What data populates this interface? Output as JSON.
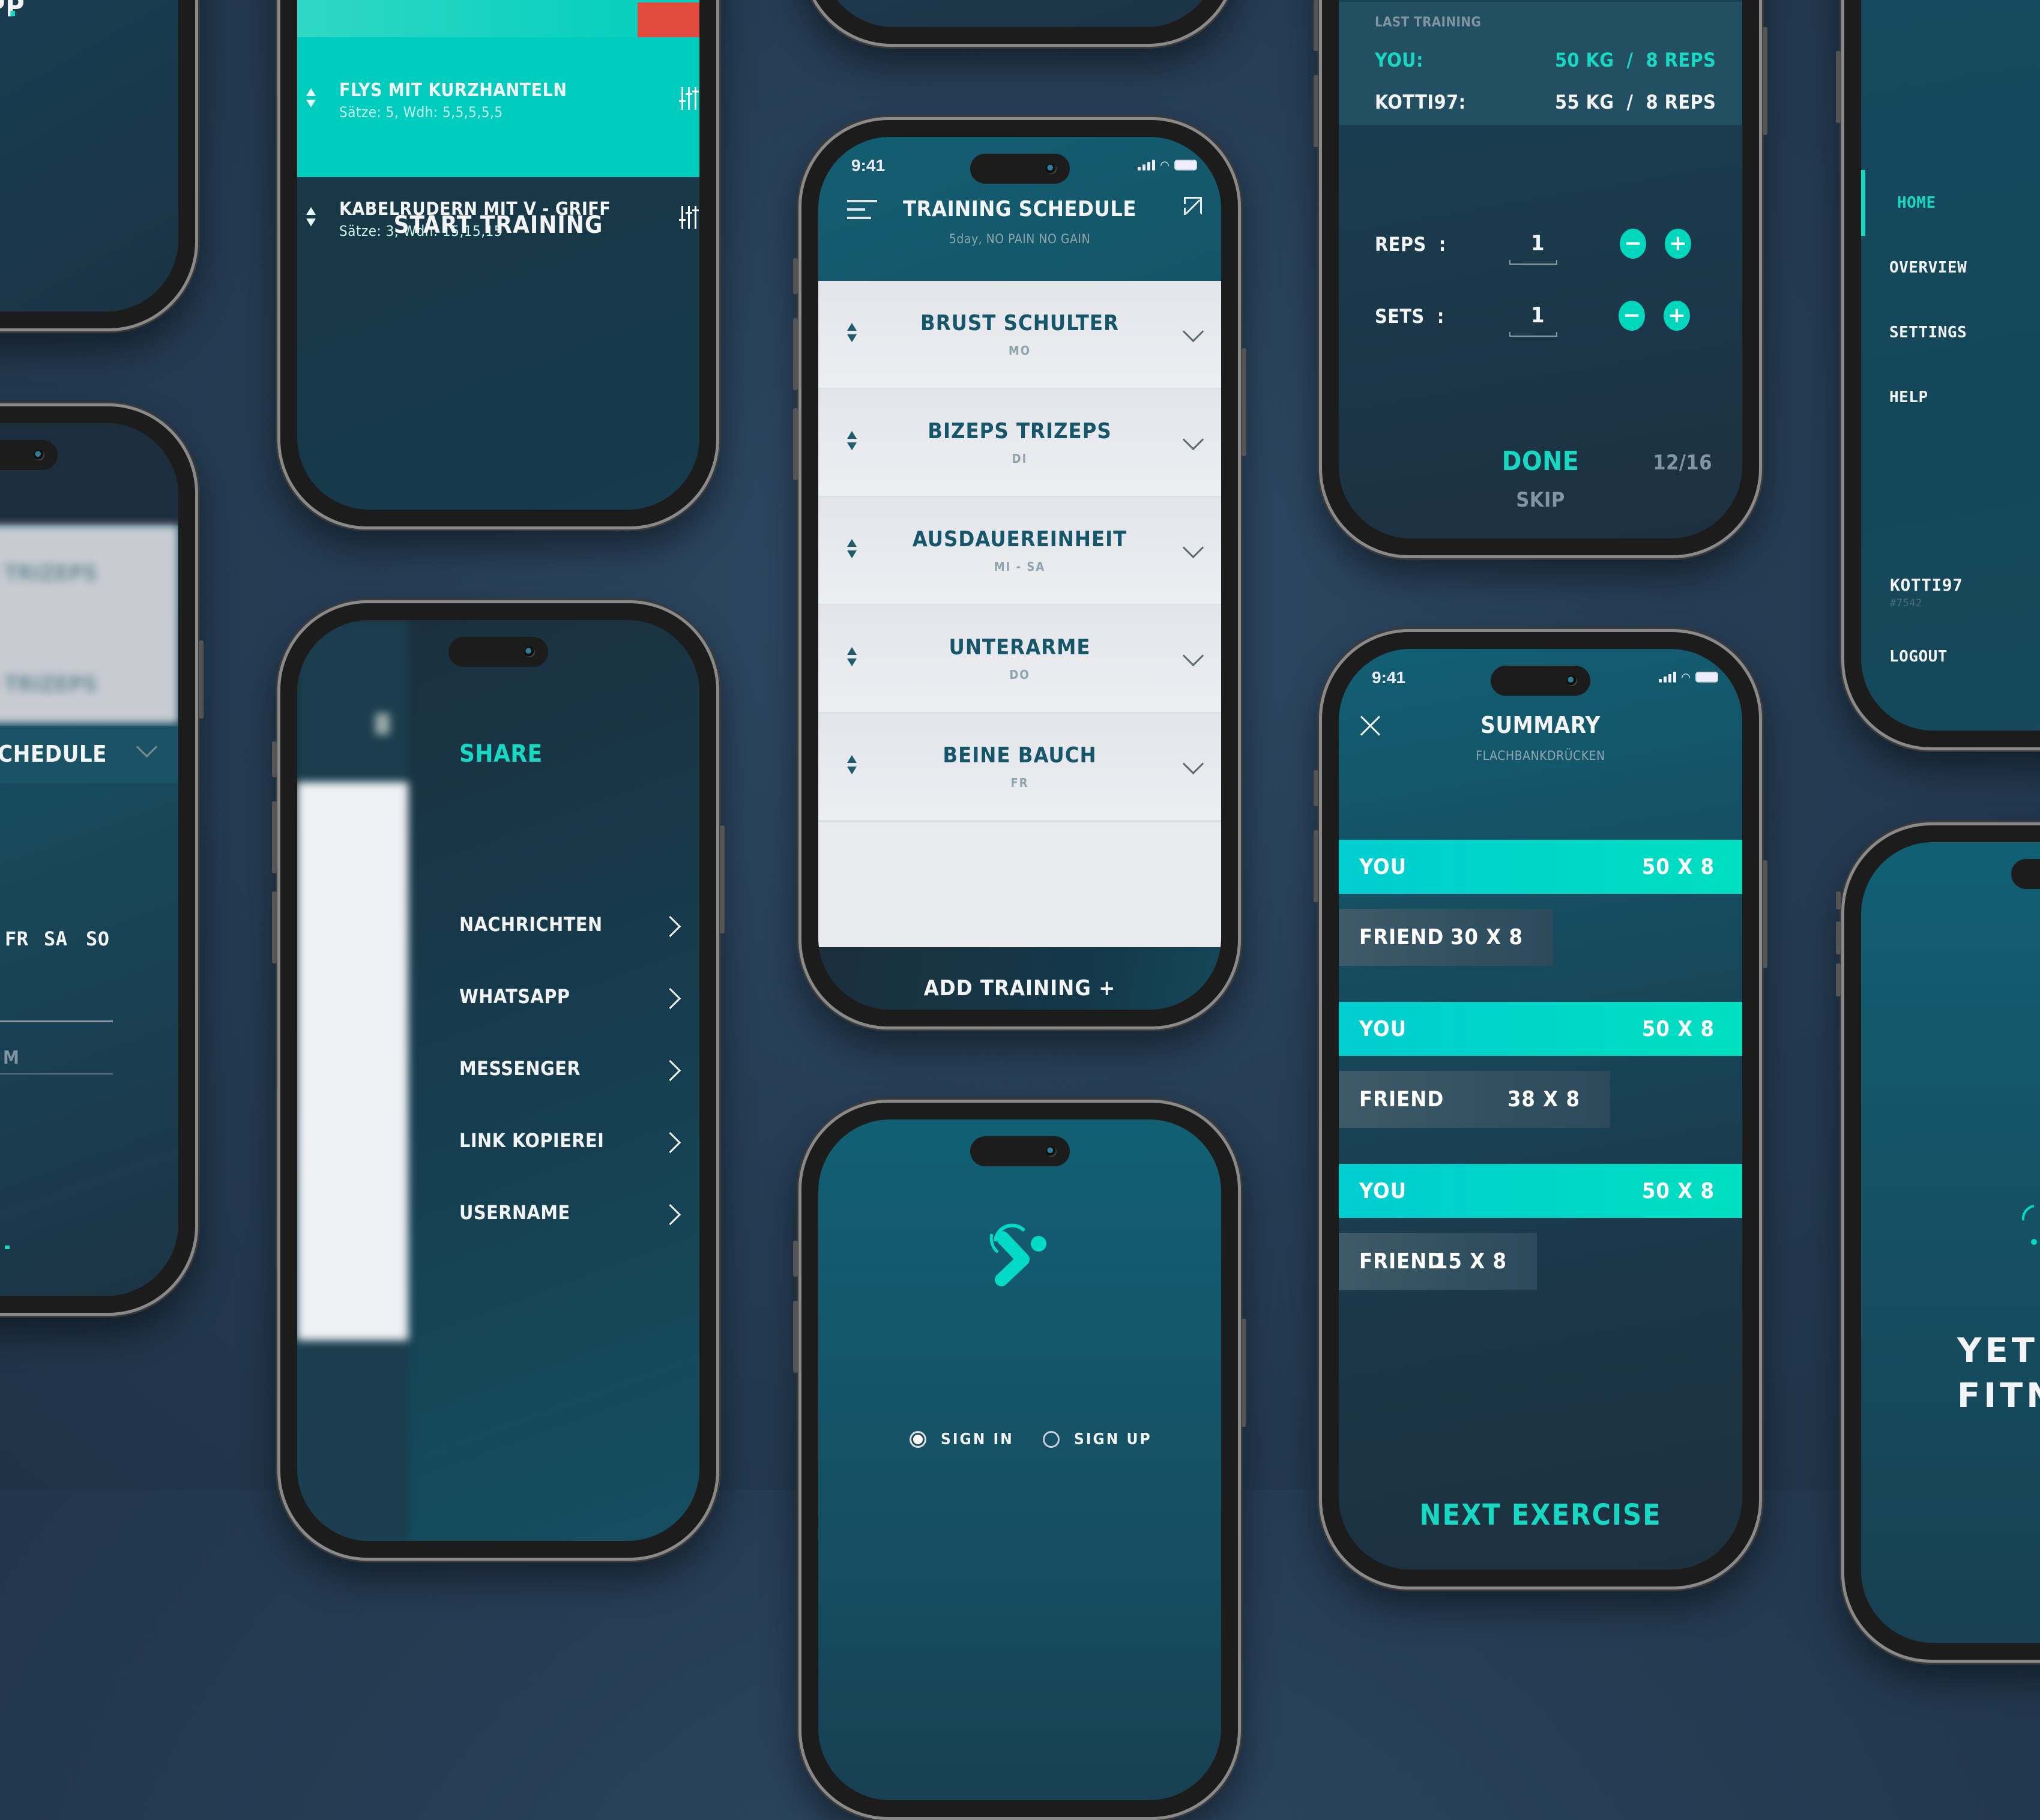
{
  "colors": {
    "accent_teal": "#16d9c3",
    "background": "#263d55",
    "screen_dark": "#174a5d",
    "list_light": "#e6e8ec",
    "alert_red": "#e34b3e"
  },
  "phone_top_left": {
    "title_fragment": "APP",
    "title_dot": "."
  },
  "phone_blurred_schedule": {
    "rows": [
      "BIZEPS TRIZEPS",
      "BIZEPS TRIZEPS"
    ],
    "section_label": "SCHEDULE",
    "days_visible": [
      "FR",
      "SA",
      "SO"
    ],
    "input_placeholder_fragment": "M"
  },
  "phone_exercises": {
    "exercises": [
      {
        "name": "FLYS MIT KURZHANTELN",
        "details": "Sätze: 5, Wdh: 5,5,5,5,5",
        "adjust_icon": "sliders-icon"
      },
      {
        "name": "KABELRUDERN MIT V - GRIFF",
        "details": "Sätze: 3, Wdh: 15,15,15",
        "adjust_icon": "sliders-icon"
      }
    ],
    "start_button": "START TRAINING"
  },
  "phone_share": {
    "title": "SHARE",
    "options": [
      {
        "label": "NACHRICHTEN"
      },
      {
        "label": "WHATSAPP"
      },
      {
        "label": "MESSENGER"
      },
      {
        "label": "LINK KOPIEREI"
      },
      {
        "label": "USERNAME"
      }
    ]
  },
  "phone_schedule": {
    "status_time": "9:41",
    "title": "TRAINING SCHEDULE",
    "subtitle": "5day, NO PAIN NO GAIN",
    "menu_icon": "hamburger-menu-icon",
    "share_icon": "share-arrow-icon",
    "days": [
      {
        "name": "BRUST SCHULTER",
        "day": "MO"
      },
      {
        "name": "BIZEPS TRIZEPS",
        "day": "DI"
      },
      {
        "name": "AUSDAUEREINHEIT",
        "day": "MI - SA"
      },
      {
        "name": "UNTERARME",
        "day": "DO"
      },
      {
        "name": "BEINE BAUCH",
        "day": "FR"
      }
    ],
    "add_button": "ADD TRAINING +"
  },
  "phone_login": {
    "logo_icon": "runner-logo-icon",
    "options": [
      {
        "label": "SIGN IN",
        "selected": true
      },
      {
        "label": "SIGN UP",
        "selected": false
      }
    ]
  },
  "phone_last_training": {
    "section_label": "LAST TRAINING",
    "you_label": "YOU:",
    "you_value": "50 KG  /  8 REPS",
    "friend_label": "KOTTI97:",
    "friend_value": "55 KG  /  8 REPS",
    "reps_label": "REPS  :",
    "reps_value": "1",
    "sets_label": "SETS  :",
    "sets_value": "1",
    "minus": "−",
    "plus": "+",
    "done_button": "DONE",
    "skip_button": "SKIP",
    "progress": "12/16"
  },
  "phone_summary": {
    "status_time": "9:41",
    "title": "SUMMARY",
    "subtitle": "FLACHBANKDRÜCKEN",
    "comparisons": [
      {
        "you_label": "YOU",
        "you_value": "50 X 8",
        "you_weight": 50,
        "friend_label": "FRIEND",
        "friend_value": "30 X 8",
        "friend_weight": 30
      },
      {
        "you_label": "YOU",
        "you_value": "50 X 8",
        "you_weight": 50,
        "friend_label": "FRIEND",
        "friend_value": "38 X 8",
        "friend_weight": 38
      },
      {
        "you_label": "YOU",
        "you_value": "50 X 8",
        "you_weight": 50,
        "friend_label": "FRIEND",
        "friend_value": "15 X 8",
        "friend_weight": 15
      }
    ],
    "next_button": "NEXT EXERCISE"
  },
  "phone_menu": {
    "items": [
      {
        "label": "HOME",
        "active": true
      },
      {
        "label": "OVERVIEW",
        "active": false
      },
      {
        "label": "SETTINGS",
        "active": false
      },
      {
        "label": "HELP",
        "active": false
      }
    ],
    "username": "KOTTI97",
    "user_tag": "#7542",
    "logout": "LOGOUT"
  },
  "phone_welcome": {
    "headline_line1": "YET A",
    "headline_line2": "FITNE"
  }
}
